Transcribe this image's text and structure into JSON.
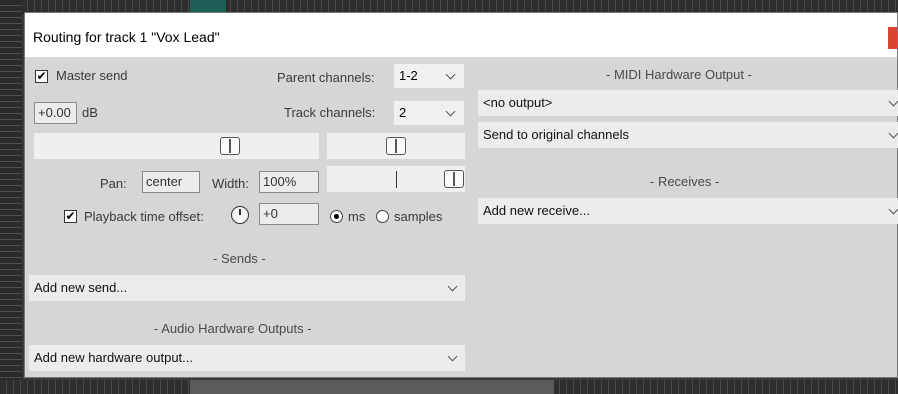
{
  "dialog": {
    "title": "Routing for track 1 \"Vox Lead\""
  },
  "master_send": {
    "label": "Master send",
    "checked": true,
    "check_glyph": "✔"
  },
  "parent_channels": {
    "label": "Parent channels:",
    "value": "1-2"
  },
  "track_channels": {
    "label": "Track channels:",
    "value": "2"
  },
  "volume": {
    "value": "+0.00",
    "unit": "dB"
  },
  "pan": {
    "label": "Pan:",
    "value": "center"
  },
  "width": {
    "label": "Width:",
    "value": "100%"
  },
  "playback_offset": {
    "label": "Playback time offset:",
    "checked": true,
    "check_glyph": "✔",
    "value": "+0",
    "unit_ms": "ms",
    "unit_samples": "samples",
    "selected_unit": "ms"
  },
  "sends": {
    "heading": "- Sends -",
    "dropdown": "Add new send..."
  },
  "audio_hw": {
    "heading": "- Audio Hardware Outputs -",
    "dropdown": "Add new hardware output..."
  },
  "midi_hw": {
    "heading": "- MIDI Hardware Output -",
    "output": "<no output>",
    "channels": "Send to original channels"
  },
  "receives": {
    "heading": "- Receives -",
    "dropdown": "Add new receive..."
  },
  "icons": {
    "close": "close-icon",
    "chevron": "chevron-down-icon",
    "clock": "clock-icon"
  },
  "colors": {
    "dialog_bg": "#d6d6d6",
    "close_button": "#d9452f"
  }
}
